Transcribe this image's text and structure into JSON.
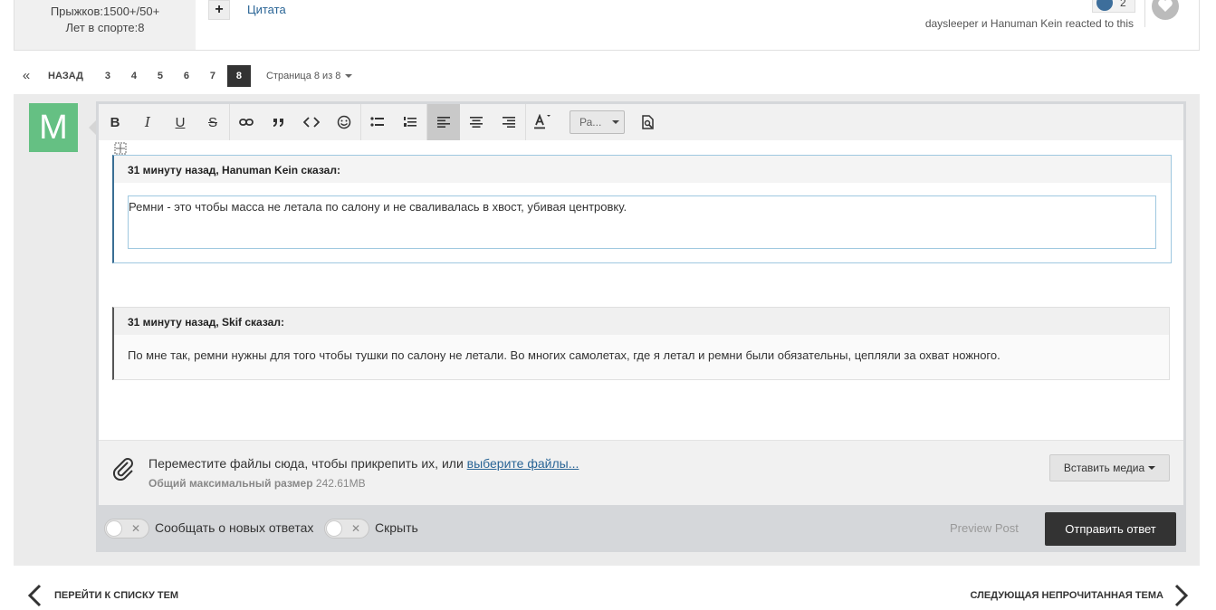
{
  "post": {
    "author_stats": [
      "Прыжков:1500+/50+",
      "Лет в спорте:8"
    ],
    "plus_label": "+",
    "quote_label": "Цитата",
    "reaction_count": "2",
    "reacted_text": "daysleeper и Hanuman Kein reacted to this"
  },
  "pagination": {
    "first": "«",
    "prev": "НАЗАД",
    "pages": [
      "3",
      "4",
      "5",
      "6",
      "7",
      "8"
    ],
    "current": "8",
    "info": "Страница 8 из 8"
  },
  "avatar": {
    "letter": "M",
    "color": "#65c083"
  },
  "toolbar": {
    "bold": "B",
    "italic": "I",
    "underline": "U",
    "strike": "S",
    "size_select": "Ра..."
  },
  "quotes": [
    {
      "header": "31 минуту назад, Hanuman Kein сказал:",
      "text": "Ремни - это чтобы масса не летала по салону и не сваливалась в хвост, убивая центровку."
    },
    {
      "header": "31 минуту назад, Skif сказал:",
      "text": "По мне так, ремни нужны для того чтобы тушки по салону не летали. Во многих самолетах, где я летал и ремни были обязательны, цепляли за охват ножного."
    }
  ],
  "attachments": {
    "drop_text": "Переместите файлы сюда, чтобы прикрепить их, или",
    "choose_link": "выберите файлы...",
    "max_size_label": "Общий максимальный размер",
    "max_size_value": "242.61MB",
    "insert_media": "Вставить медиа"
  },
  "options": {
    "notify_label": "Сообщать о новых ответах",
    "hide_label": "Скрыть",
    "toggle_off": "✕",
    "preview": "Preview Post",
    "submit": "Отправить ответ"
  },
  "footer": {
    "back_to_list": "ПЕРЕЙТИ К СПИСКУ ТЕМ",
    "next_unread": "СЛЕДУЮЩАЯ НЕПРОЧИТАННАЯ ТЕМА"
  },
  "colors": {
    "accent": "#333333",
    "link": "#2a6596",
    "quote_border": "#3a6e94"
  }
}
